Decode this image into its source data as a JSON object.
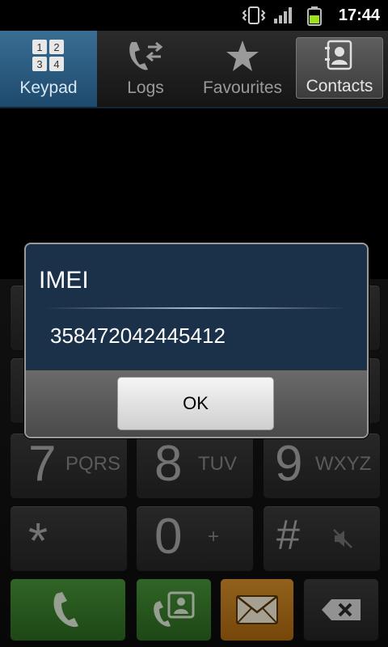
{
  "status_bar": {
    "time": "17:44",
    "icons": [
      "vibrate-icon",
      "signal-icon",
      "battery-icon"
    ]
  },
  "tabs": [
    {
      "label": "Keypad",
      "icon": "keypad-icon",
      "active": true
    },
    {
      "label": "Logs",
      "icon": "logs-icon"
    },
    {
      "label": "Favourites",
      "icon": "star-icon"
    },
    {
      "label": "Contacts",
      "icon": "contacts-icon"
    }
  ],
  "keypad": {
    "keys": [
      {
        "num": "7",
        "letters": "PQRS"
      },
      {
        "num": "8",
        "letters": "TUV"
      },
      {
        "num": "9",
        "letters": "WXYZ"
      },
      {
        "num": "*",
        "letters": ""
      },
      {
        "num": "0",
        "letters": "+"
      },
      {
        "num": "#",
        "letters": ""
      }
    ]
  },
  "dialog": {
    "title": "IMEI",
    "value": "358472042445412",
    "ok_label": "OK"
  },
  "colors": {
    "tab_active": "#2d5f86",
    "dialog_bg": "#1b3049",
    "call_green": "#3e8a2f",
    "message_orange": "#d1861f"
  }
}
